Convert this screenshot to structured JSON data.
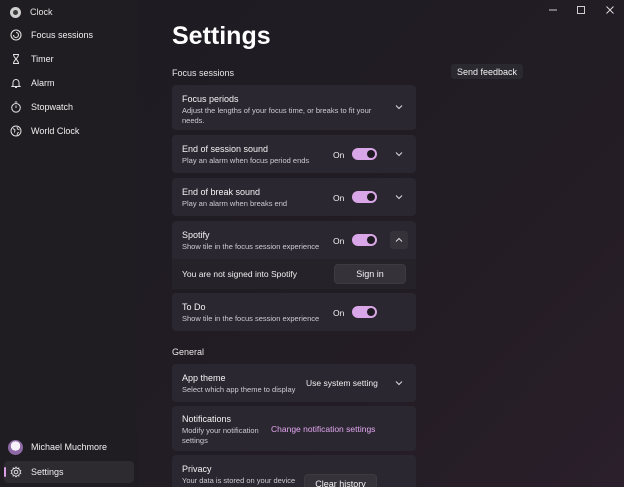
{
  "app": {
    "title": "Clock"
  },
  "sidebar": {
    "items": [
      {
        "label": "Focus sessions",
        "icon": "focus-icon"
      },
      {
        "label": "Timer",
        "icon": "hourglass-icon"
      },
      {
        "label": "Alarm",
        "icon": "alarm-icon"
      },
      {
        "label": "Stopwatch",
        "icon": "stopwatch-icon"
      },
      {
        "label": "World Clock",
        "icon": "globe-icon"
      }
    ],
    "user": "Michael Muchmore",
    "settings": "Settings"
  },
  "page": {
    "title": "Settings",
    "feedback": "Send feedback"
  },
  "focus": {
    "heading": "Focus sessions",
    "periods": {
      "title": "Focus periods",
      "desc1": "Adjust the lengths of your focus time, or breaks to fit your",
      "desc2": "needs."
    },
    "end_session": {
      "title": "End of session sound",
      "desc": "Play an alarm when focus period ends",
      "state": "On"
    },
    "end_break": {
      "title": "End of break sound",
      "desc": "Play an alarm when breaks end",
      "state": "On"
    },
    "spotify": {
      "title": "Spotify",
      "desc": "Show tile in the focus session experience",
      "state": "On",
      "signin_text": "You are not signed into Spotify",
      "signin_btn": "Sign in"
    },
    "todo": {
      "title": "To Do",
      "desc": "Show tile in the focus session experience",
      "state": "On"
    }
  },
  "general": {
    "heading": "General",
    "theme": {
      "title": "App theme",
      "desc": "Select which app theme to display",
      "value": "Use system setting"
    },
    "notifications": {
      "title": "Notifications",
      "desc1": "Modify your notification",
      "desc2": "settings",
      "link": "Change notification settings"
    },
    "privacy": {
      "title": "Privacy",
      "desc": "Your data is stored on your device",
      "btn": "Clear history"
    }
  },
  "colors": {
    "accent": "#d9a6e8",
    "link": "#e2a7f0"
  }
}
